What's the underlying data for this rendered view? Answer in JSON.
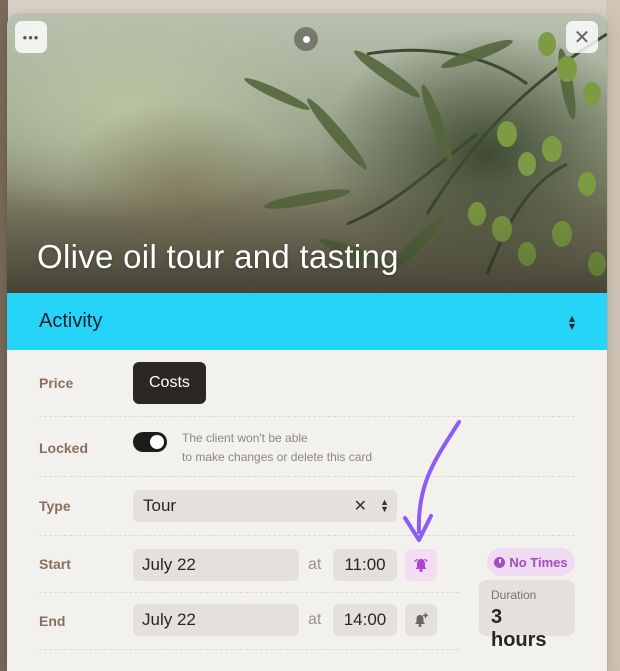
{
  "card": {
    "title": "Olive oil tour and tasting",
    "more_icon": "more-horizontal-icon",
    "close_icon": "close-icon",
    "drag_icon": "drag-handle-icon"
  },
  "activity": {
    "label": "Activity",
    "icon": "chevron-up-down-icon"
  },
  "price": {
    "label": "Price",
    "info_icon": "info-icon",
    "button_label": "Costs"
  },
  "locked": {
    "label": "Locked",
    "enabled": true,
    "note_line1": "The client won't be able",
    "note_line2": "to make changes or delete this card"
  },
  "type": {
    "label": "Type",
    "value": "Tour"
  },
  "start": {
    "label": "Start",
    "date": "July 22",
    "at": "at",
    "time": "11:00",
    "reminder_icon": "bell-active-icon"
  },
  "end": {
    "label": "End",
    "date": "July 22",
    "at": "at",
    "time": "14:00",
    "reminder_icon": "bell-add-icon"
  },
  "no_times": {
    "label": "No Times"
  },
  "duration": {
    "label": "Duration",
    "value": "3 hours"
  },
  "colors": {
    "activity_bar": "#26d4f7",
    "accent_purple": "#8b5cf6",
    "no_times_text": "#a64bc0"
  }
}
